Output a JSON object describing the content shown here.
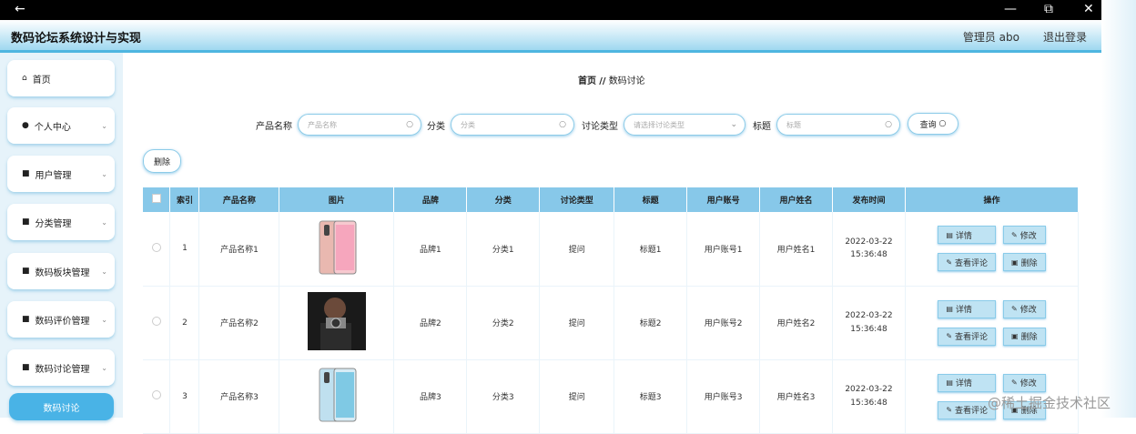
{
  "window": {
    "back_icon": "←",
    "min_icon": "—",
    "max_icon": "⧉",
    "close_icon": "✕"
  },
  "header": {
    "title": "数码论坛系统设计与实现",
    "user": "管理员 abo",
    "logout": "退出登录"
  },
  "sidebar": {
    "items": [
      {
        "icon": "⌂",
        "label": "首页"
      },
      {
        "icon": "●",
        "label": "个人中心"
      },
      {
        "icon": "■",
        "label": "用户管理"
      },
      {
        "icon": "■",
        "label": "分类管理"
      },
      {
        "icon": "■",
        "label": "数码板块管理"
      },
      {
        "icon": "■",
        "label": "数码评价管理"
      },
      {
        "icon": "■",
        "label": "数码讨论管理"
      },
      {
        "label": "数码讨论"
      }
    ]
  },
  "breadcrumb": {
    "home": "首页",
    "sep": "//",
    "current": "数码讨论"
  },
  "search": {
    "product_label": "产品名称",
    "product_placeholder": "产品名称",
    "category_label": "分类",
    "category_placeholder": "分类",
    "type_label": "讨论类型",
    "type_placeholder": "请选择讨论类型",
    "title_label": "标题",
    "title_placeholder": "标题",
    "query_label": "查询"
  },
  "toolbar": {
    "delete_label": "删除"
  },
  "table": {
    "headers": [
      "",
      "索引",
      "产品名称",
      "图片",
      "品牌",
      "分类",
      "讨论类型",
      "标题",
      "用户账号",
      "用户姓名",
      "发布时间",
      "操作"
    ],
    "rows": [
      {
        "index": "1",
        "name": "产品名称1",
        "brand": "品牌1",
        "category": "分类1",
        "type": "提问",
        "title": "标题1",
        "account": "用户账号1",
        "username": "用户姓名1",
        "time": "2022-03-22 15:36:48"
      },
      {
        "index": "2",
        "name": "产品名称2",
        "brand": "品牌2",
        "category": "分类2",
        "type": "提问",
        "title": "标题2",
        "account": "用户账号2",
        "username": "用户姓名2",
        "time": "2022-03-22 15:36:48"
      },
      {
        "index": "3",
        "name": "产品名称3",
        "brand": "品牌3",
        "category": "分类3",
        "type": "提问",
        "title": "标题3",
        "account": "用户账号3",
        "username": "用户姓名3",
        "time": "2022-03-22 15:36:48"
      }
    ],
    "ops": {
      "detail": "详情",
      "edit": "修改",
      "comments": "查看评论",
      "delete": "删除"
    }
  },
  "watermark": "@稀土掘金技术社区"
}
